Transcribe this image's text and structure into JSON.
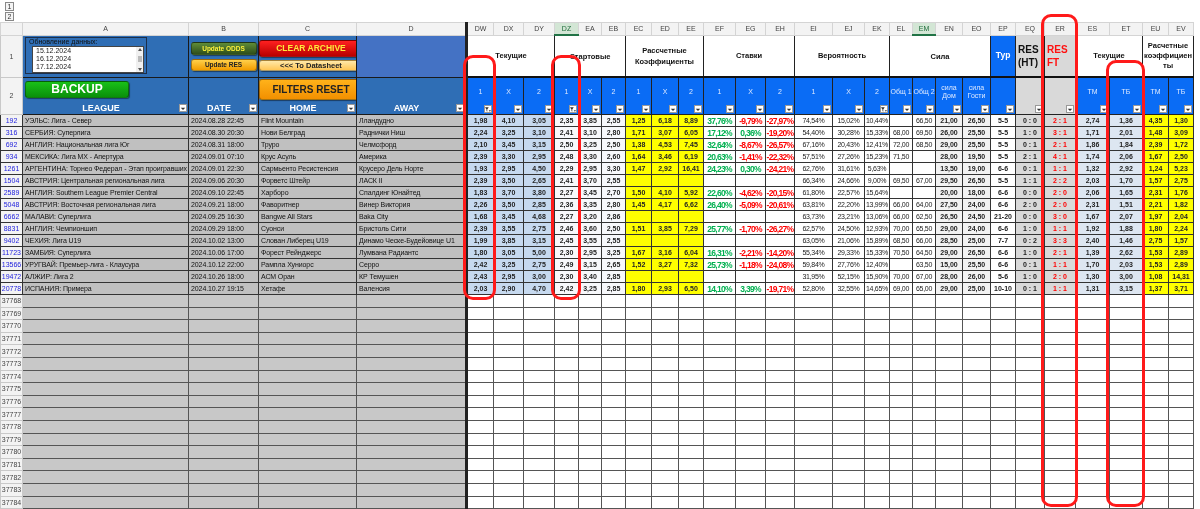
{
  "outline_levels": [
    "1",
    "2"
  ],
  "columns": [
    {
      "letter": "A",
      "selected": false
    },
    {
      "letter": "B",
      "selected": false
    },
    {
      "letter": "C",
      "selected": false
    },
    {
      "letter": "D",
      "selected": false
    },
    {
      "letter": "DW",
      "selected": false,
      "circled": true
    },
    {
      "letter": "DX",
      "selected": false
    },
    {
      "letter": "DY",
      "selected": false
    },
    {
      "letter": "DZ",
      "selected": true,
      "circled": true
    },
    {
      "letter": "EA",
      "selected": false
    },
    {
      "letter": "EB",
      "selected": false
    },
    {
      "letter": "EC",
      "selected": false
    },
    {
      "letter": "ED",
      "selected": false
    },
    {
      "letter": "EE",
      "selected": false
    },
    {
      "letter": "EF",
      "selected": false
    },
    {
      "letter": "EG",
      "selected": false
    },
    {
      "letter": "EH",
      "selected": false
    },
    {
      "letter": "EI",
      "selected": false
    },
    {
      "letter": "EJ",
      "selected": false
    },
    {
      "letter": "EK",
      "selected": false
    },
    {
      "letter": "EL",
      "selected": false
    },
    {
      "letter": "EM",
      "selected": true
    },
    {
      "letter": "EN",
      "selected": false
    },
    {
      "letter": "EO",
      "selected": false
    },
    {
      "letter": "EP",
      "selected": false
    },
    {
      "letter": "EQ",
      "selected": false
    },
    {
      "letter": "ER",
      "selected": false,
      "circled": true
    },
    {
      "letter": "ES",
      "selected": false
    },
    {
      "letter": "ET",
      "selected": false,
      "circled": true
    },
    {
      "letter": "EU",
      "selected": false
    },
    {
      "letter": "EV",
      "selected": false
    }
  ],
  "header_rows": [
    "1",
    "2"
  ],
  "update_box": {
    "legend": "Обновление данных:",
    "items": [
      {
        "label": "15.12.2024",
        "selected": false
      },
      {
        "label": "16.12.2024",
        "selected": false
      },
      {
        "label": "17.12.2024",
        "selected": false
      }
    ]
  },
  "update_odds_button": "Update ODDS",
  "update_res_button": "Update RES",
  "clear_archive_button": "CLEAR ARCHIVE",
  "to_datasheet_button": "<<< To Datasheet",
  "backup_button": "BACKUP",
  "filters_reset_button": "FILTERS RESET",
  "left_headers": [
    {
      "label": "LEAGUE",
      "filtered": false
    },
    {
      "label": "DATE",
      "filtered": false
    },
    {
      "label": "HOME",
      "filtered": false
    },
    {
      "label": "AWAY",
      "filtered": false
    }
  ],
  "groups": [
    {
      "title": "Текущие",
      "kind": "plain",
      "subheaders": [
        {
          "label": "1",
          "filtered": true
        },
        {
          "label": "X",
          "filtered": false
        },
        {
          "label": "2",
          "filtered": false
        }
      ]
    },
    {
      "title": "Стартовые",
      "kind": "plain",
      "subheaders": [
        {
          "label": "1",
          "filtered": true
        },
        {
          "label": "X",
          "filtered": false
        },
        {
          "label": "2",
          "filtered": false
        }
      ]
    },
    {
      "title": "Рассчетные Коэффициенты",
      "kind": "plain",
      "subheaders": [
        {
          "label": "1",
          "filtered": false
        },
        {
          "label": "X",
          "filtered": false
        },
        {
          "label": "2",
          "filtered": false
        }
      ]
    },
    {
      "title": "Ставки",
      "kind": "plain",
      "subheaders": [
        {
          "label": "1",
          "filtered": false
        },
        {
          "label": "X",
          "filtered": false
        },
        {
          "label": "2",
          "filtered": false
        }
      ]
    },
    {
      "title": "Вероятность",
      "kind": "plain",
      "subheaders": [
        {
          "label": "1",
          "filtered": false
        },
        {
          "label": "X",
          "filtered": false
        },
        {
          "label": "2",
          "filtered": true
        }
      ]
    },
    {
      "title": "Сила",
      "kind": "plain",
      "subheaders": [
        {
          "label": "Общ 1",
          "filtered": false
        },
        {
          "label": "Общ 2",
          "filtered": false
        },
        {
          "label": "сила Дом",
          "filtered": false
        },
        {
          "label": "сила Гости",
          "filtered": false
        }
      ]
    },
    {
      "title": "Тур",
      "kind": "blue",
      "subheaders": [
        {
          "filtered": false
        }
      ]
    },
    {
      "title": "RES (HT)",
      "kind": "grey",
      "subheaders": [
        {
          "filtered": false
        }
      ]
    },
    {
      "title": "RES FT",
      "kind": "grey-alert",
      "subheaders": [
        {
          "filtered": false
        }
      ]
    },
    {
      "title": "Текущие",
      "kind": "plain",
      "subheaders": [
        {
          "label": "ТМ",
          "filtered": false
        },
        {
          "label": "ТБ",
          "filtered": false
        }
      ]
    },
    {
      "title": "Расчетные коэффициенты",
      "kind": "plain",
      "subheaders": [
        {
          "label": "ТМ",
          "filtered": false
        },
        {
          "label": "ТБ",
          "filtered": false
        }
      ]
    }
  ],
  "rows": [
    {
      "num": "192",
      "league": "УЭЛЬС: Лига - Север",
      "date": "2024.08.28 22:45",
      "home": "Flint Mountain",
      "away": "Лландудно",
      "current": [
        "1,98",
        "4,10",
        "3,05"
      ],
      "start": [
        "2,35",
        "3,85",
        "2,55"
      ],
      "calc": [
        "1,25",
        "6,18",
        "8,89"
      ],
      "stakes": [
        {
          "value": "37,76%",
          "color": "#00b050"
        },
        {
          "value": "-9,79%",
          "color": "#ff0000"
        },
        {
          "value": "-27,97%",
          "color": "#ff0000"
        }
      ],
      "prob": [
        "74,54%",
        "15,02%",
        "10,44%"
      ],
      "power": {
        "total_2": "66,50",
        "home": "21,00",
        "away": "26,50"
      },
      "tour": "5-5",
      "res_ht": "0 : 0",
      "res_ft": "2 : 1",
      "totals": [
        "2,74",
        "1,36"
      ],
      "calc_totals": [
        "4,35",
        "1,30"
      ]
    },
    {
      "num": "316",
      "league": "СЕРБИЯ: Суперлига",
      "date": "2024.08.30 20:30",
      "home": "Нови Белград",
      "away": "Раднички Ниш",
      "current": [
        "2,24",
        "3,25",
        "3,10"
      ],
      "start": [
        "2,41",
        "3,10",
        "2,80"
      ],
      "calc": [
        "1,71",
        "3,07",
        "6,05"
      ],
      "stakes": [
        {
          "value": "17,12%",
          "color": "#00b050"
        },
        {
          "value": "0,36%",
          "color": "#00b050"
        },
        {
          "value": "-19,20%",
          "color": "#ff0000"
        }
      ],
      "prob": [
        "54,40%",
        "30,28%",
        "15,33%"
      ],
      "power": {
        "total_1": "68,00",
        "total_2": "69,50",
        "home": "26,00",
        "away": "25,50"
      },
      "tour": "5-5",
      "res_ht": "1 : 0",
      "res_ft": "3 : 1",
      "totals": [
        "1,71",
        "2,01"
      ],
      "calc_totals": [
        "1,48",
        "3,09"
      ]
    },
    {
      "num": "692",
      "league": "АНГЛИЯ: Национальная лига Юг",
      "date": "2024.08.31 18:00",
      "home": "Труро",
      "away": "Челмсфорд",
      "current": [
        "2,10",
        "3,45",
        "3,15"
      ],
      "start": [
        "2,50",
        "3,25",
        "2,50"
      ],
      "calc": [
        "1,38",
        "4,53",
        "7,45"
      ],
      "stakes": [
        {
          "value": "32,64%",
          "color": "#00b050"
        },
        {
          "value": "-8,67%",
          "color": "#ff0000"
        },
        {
          "value": "-26,57%",
          "color": "#ff0000"
        }
      ],
      "prob": [
        "67,16%",
        "20,43%",
        "12,41%"
      ],
      "power": {
        "total_1": "72,00",
        "total_2": "68,50",
        "home": "29,00",
        "away": "25,50"
      },
      "tour": "5-5",
      "res_ht": "0 : 1",
      "res_ft": "2 : 1",
      "totals": [
        "1,86",
        "1,84"
      ],
      "calc_totals": [
        "2,39",
        "1,72"
      ]
    },
    {
      "num": "934",
      "league": "МЕКСИКА: Лига MX - Апертура",
      "date": "2024.09.01 07:10",
      "home": "Крус Асуль",
      "away": "Америка",
      "current": [
        "2,39",
        "3,30",
        "2,95"
      ],
      "start": [
        "2,48",
        "3,30",
        "2,60"
      ],
      "calc": [
        "1,64",
        "3,46",
        "6,19"
      ],
      "stakes": [
        {
          "value": "20,63%",
          "color": "#00b050"
        },
        {
          "value": "-1,41%",
          "color": "#ff0000"
        },
        {
          "value": "-22,32%",
          "color": "#ff0000"
        }
      ],
      "prob": [
        "57,51%",
        "27,26%",
        "15,23%"
      ],
      "power": {
        "total_1": "71,50",
        "home": "28,00",
        "away": "19,50"
      },
      "tour": "5-5",
      "res_ht": "2 : 1",
      "res_ft": "4 : 1",
      "totals": [
        "1,74",
        "2,06"
      ],
      "calc_totals": [
        "1,67",
        "2,50"
      ]
    },
    {
      "num": "1261",
      "league": "АРГЕНТИНА: Торнео Федерал - Этап проигравших",
      "date": "2024.09.01 22:30",
      "home": "Сармьенто Ресистенсия",
      "away": "Крусеро Дель Норте",
      "current": [
        "1,93",
        "2,95",
        "4,50"
      ],
      "start": [
        "2,29",
        "2,95",
        "3,30"
      ],
      "calc": [
        "1,47",
        "2,92",
        "16,41"
      ],
      "stakes": [
        {
          "value": "24,23%",
          "color": "#00b050"
        },
        {
          "value": "0,30%",
          "color": "#00b050"
        },
        {
          "value": "-24,21%",
          "color": "#ff0000"
        }
      ],
      "prob": [
        "62,76%",
        "31,61%",
        "5,63%"
      ],
      "power": {
        "home": "13,50",
        "away": "19,00"
      },
      "tour": "6-6",
      "res_ht": "0 : 1",
      "res_ft": "1 : 1",
      "totals": [
        "1,32",
        "2,92"
      ],
      "calc_totals": [
        "1,24",
        "5,23"
      ]
    },
    {
      "num": "1504",
      "league": "АВСТРИЯ: Центральная региональная лига",
      "date": "2024.09.06 20:30",
      "home": "Форветс Штейр",
      "away": "ЛАСК II",
      "current": [
        "2,39",
        "3,50",
        "2,65"
      ],
      "start": [
        "2,41",
        "3,70",
        "2,55"
      ],
      "prob": [
        "66,34%",
        "24,66%",
        "9,00%"
      ],
      "power": {
        "total_1": "69,50",
        "total_2": "67,00",
        "home": "29,50",
        "away": "26,50"
      },
      "tour": "5-5",
      "res_ht": "1 : 1",
      "res_ft": "2 : 2",
      "totals": [
        "2,03",
        "1,70"
      ],
      "calc_totals": [
        "1,57",
        "2,75"
      ]
    },
    {
      "num": "2589",
      "league": "АНГЛИЯ: Southern League Premier Central",
      "date": "2024.09.10 22:45",
      "home": "Харборо",
      "away": "Спалдинг Юнайтед",
      "current": [
        "1,83",
        "3,70",
        "3,80"
      ],
      "start": [
        "2,27",
        "3,45",
        "2,70"
      ],
      "calc": [
        "1,50",
        "4,10",
        "5,92"
      ],
      "stakes": [
        {
          "value": "22,60%",
          "color": "#00b050"
        },
        {
          "value": "-4,62%",
          "color": "#ff0000"
        },
        {
          "value": "-20,15%",
          "color": "#ff0000"
        }
      ],
      "prob": [
        "61,80%",
        "22,57%",
        "15,64%"
      ],
      "power": {
        "home": "20,00",
        "away": "18,00"
      },
      "tour": "6-6",
      "res_ht": "0 : 0",
      "res_ft": "2 : 0",
      "totals": [
        "2,06",
        "1,65"
      ],
      "calc_totals": [
        "2,31",
        "1,76"
      ]
    },
    {
      "num": "5048",
      "league": "АВСТРИЯ: Восточная региональная лига",
      "date": "2024.09.21 18:00",
      "home": "Фаворитнер",
      "away": "Винер Виктория",
      "current": [
        "2,26",
        "3,50",
        "2,85"
      ],
      "start": [
        "2,36",
        "3,35",
        "2,80"
      ],
      "calc": [
        "1,45",
        "4,17",
        "6,62"
      ],
      "stakes": [
        {
          "value": "26,40%",
          "color": "#00b050"
        },
        {
          "value": "-5,09%",
          "color": "#ff0000"
        },
        {
          "value": "-20,61%",
          "color": "#ff0000"
        }
      ],
      "prob": [
        "63,81%",
        "22,20%",
        "13,99%"
      ],
      "power": {
        "total_1": "66,00",
        "total_2": "64,00",
        "home": "27,50",
        "away": "24,00"
      },
      "tour": "6-6",
      "res_ht": "2 : 0",
      "res_ft": "2 : 0",
      "totals": [
        "2,31",
        "1,51"
      ],
      "calc_totals": [
        "2,21",
        "1,82"
      ]
    },
    {
      "num": "6662",
      "league": "МАЛАВИ: Суперлига",
      "date": "2024.09.25 16:30",
      "home": "Bangwe All Stars",
      "away": "Baka City",
      "current": [
        "1,68",
        "3,45",
        "4,68"
      ],
      "start": [
        "2,27",
        "3,20",
        "2,86"
      ],
      "prob": [
        "63,73%",
        "23,21%",
        "13,06%"
      ],
      "power": {
        "total_1": "66,00",
        "total_2": "62,50",
        "home": "26,50",
        "away": "24,50"
      },
      "tour": "21-20",
      "res_ht": "0 : 0",
      "res_ft": "3 : 0",
      "totals": [
        "1,67",
        "2,07"
      ],
      "calc_totals": [
        "1,97",
        "2,04"
      ]
    },
    {
      "num": "8831",
      "league": "АНГЛИЯ: Чемпионшип",
      "date": "2024.09.29 18:00",
      "home": "Суонси",
      "away": "Бристоль Сити",
      "current": [
        "2,39",
        "3,55",
        "2,75"
      ],
      "start": [
        "2,46",
        "3,60",
        "2,50"
      ],
      "calc": [
        "1,51",
        "3,85",
        "7,29"
      ],
      "stakes": [
        {
          "value": "25,77%",
          "color": "#00b050"
        },
        {
          "value": "-1,70%",
          "color": "#ff0000"
        },
        {
          "value": "-26,27%",
          "color": "#ff0000"
        }
      ],
      "prob": [
        "62,57%",
        "24,50%",
        "12,93%"
      ],
      "power": {
        "total_1": "70,00",
        "total_2": "65,50",
        "home": "29,00",
        "away": "24,00"
      },
      "tour": "6-6",
      "res_ht": "1 : 0",
      "res_ft": "1 : 1",
      "totals": [
        "1,92",
        "1,88"
      ],
      "calc_totals": [
        "1,80",
        "2,24"
      ]
    },
    {
      "num": "9402",
      "league": "ЧЕХИЯ: Лига U19",
      "date": "2024.10.02 13:00",
      "home": "Слован Либерец U19",
      "away": "Динамо Ческе-Будейовице U1",
      "current": [
        "1,99",
        "3,85",
        "3,15"
      ],
      "start": [
        "2,45",
        "3,55",
        "2,55"
      ],
      "prob": [
        "63,05%",
        "21,06%",
        "15,89%"
      ],
      "power": {
        "total_1": "68,50",
        "total_2": "66,00",
        "home": "28,50",
        "away": "25,00"
      },
      "tour": "7-7",
      "res_ht": "0 : 2",
      "res_ft": "3 : 3",
      "totals": [
        "2,40",
        "1,46"
      ],
      "calc_totals": [
        "2,75",
        "1,57"
      ]
    },
    {
      "num": "11723",
      "league": "ЗАМБИЯ: Суперлига",
      "date": "2024.10.06 17:00",
      "home": "Форест Рейнджерс",
      "away": "Лумвана Радиантс",
      "current": [
        "1,80",
        "3,05",
        "5,00"
      ],
      "start": [
        "2,30",
        "2,95",
        "3,25"
      ],
      "calc": [
        "1,67",
        "3,16",
        "6,04"
      ],
      "stakes": [
        {
          "value": "16,31%",
          "color": "#00b050"
        },
        {
          "value": "-2,21%",
          "color": "#ff0000"
        },
        {
          "value": "-14,20%",
          "color": "#ff0000"
        }
      ],
      "prob": [
        "55,34%",
        "29,33%",
        "15,33%"
      ],
      "power": {
        "total_1": "70,50",
        "total_2": "64,50",
        "home": "29,00",
        "away": "26,50"
      },
      "tour": "6-6",
      "res_ht": "1 : 0",
      "res_ft": "2 : 1",
      "totals": [
        "1,39",
        "2,62"
      ],
      "calc_totals": [
        "1,53",
        "2,89"
      ]
    },
    {
      "num": "13566",
      "league": "УРУГВАЙ: Премьер-лига - Клаусура",
      "date": "2024.10.12 22:00",
      "home": "Рампла Хуниорс",
      "away": "Серро",
      "current": [
        "2,42",
        "3,25",
        "2,75"
      ],
      "start": [
        "2,49",
        "3,15",
        "2,65"
      ],
      "calc": [
        "1,52",
        "3,27",
        "7,32"
      ],
      "stakes": [
        {
          "value": "25,73%",
          "color": "#00b050"
        },
        {
          "value": "-1,18%",
          "color": "#ff0000"
        },
        {
          "value": "-24,08%",
          "color": "#ff0000"
        }
      ],
      "prob": [
        "59,84%",
        "27,76%",
        "12,40%"
      ],
      "power": {
        "total_2": "63,50",
        "home": "15,00",
        "away": "25,50"
      },
      "tour": "6-6",
      "res_ht": "0 : 1",
      "res_ft": "1 : 1",
      "totals": [
        "1,70",
        "2,03"
      ],
      "calc_totals": [
        "1,53",
        "2,89"
      ]
    },
    {
      "num": "19472",
      "league": "АЛЖИР: Лига 2",
      "date": "2024.10.26 18:00",
      "home": "АСМ Оран",
      "away": "КР Темушен",
      "current": [
        "2,43",
        "2,95",
        "3,00"
      ],
      "start": [
        "2,30",
        "3,40",
        "2,85"
      ],
      "prob": [
        "31,95%",
        "52,15%",
        "15,90%"
      ],
      "power": {
        "total_1": "70,00",
        "total_2": "67,00",
        "home": "28,00",
        "away": "26,00"
      },
      "tour": "5-6",
      "res_ht": "1 : 0",
      "res_ft": "2 : 0",
      "totals": [
        "1,30",
        "3,00"
      ],
      "calc_totals": [
        "1,08",
        "14,31"
      ]
    },
    {
      "num": "20778",
      "league": "ИСПАНИЯ: Примера",
      "date": "2024.10.27 19:15",
      "home": "Хетафе",
      "away": "Валенсия",
      "current": [
        "2,03",
        "2,90",
        "4,70"
      ],
      "start": [
        "2,42",
        "3,25",
        "2,85"
      ],
      "calc": [
        "1,80",
        "2,93",
        "6,50"
      ],
      "stakes": [
        {
          "value": "14,10%",
          "color": "#00b050"
        },
        {
          "value": "3,39%",
          "color": "#00b050"
        },
        {
          "value": "-19,71%",
          "color": "#ff0000"
        }
      ],
      "prob": [
        "52,80%",
        "32,55%",
        "14,65%"
      ],
      "power": {
        "total_1": "69,00",
        "total_2": "65,00",
        "home": "29,00",
        "away": "25,00"
      },
      "tour": "10-10",
      "res_ht": "0 : 1",
      "res_ft": "1 : 1",
      "totals": [
        "1,31",
        "3,15"
      ],
      "calc_totals": [
        "1,37",
        "3,71"
      ]
    }
  ],
  "empty_rows": [
    "37768",
    "37769",
    "37770",
    "37771",
    "37772",
    "37773",
    "37774",
    "37775",
    "37776",
    "37777",
    "37778",
    "37779",
    "37780",
    "37781",
    "37782",
    "37783",
    "37784"
  ]
}
